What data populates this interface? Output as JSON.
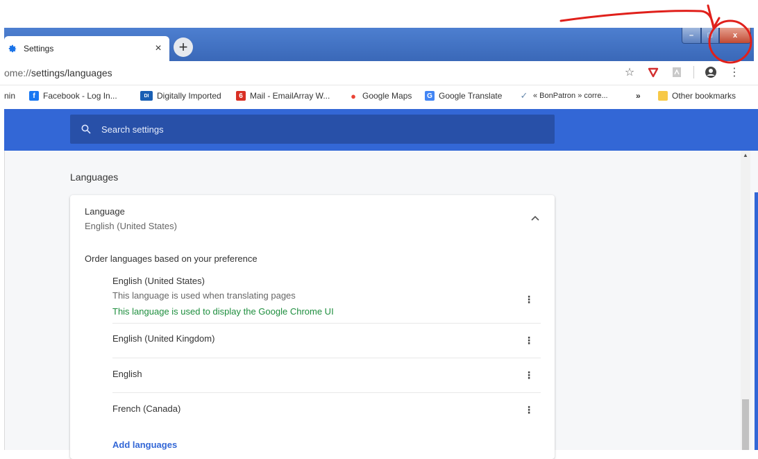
{
  "tab": {
    "title": "Settings",
    "close": "×",
    "new_tab": "+"
  },
  "window_controls": {
    "minimize": "–",
    "maximize": "□",
    "close": "x"
  },
  "omnibox": {
    "url_prefix": "ome://",
    "url_path": "settings/languages"
  },
  "bookmarks": [
    {
      "label": "nin",
      "icon_color": ""
    },
    {
      "label": "Facebook - Log In...",
      "icon_color": "#1877f2",
      "icon_glyph": "f"
    },
    {
      "label": "Digitally Imported",
      "icon_color": "#1a5fb4",
      "icon_glyph": "DI"
    },
    {
      "label": "Mail - EmailArray W...",
      "icon_color": "#d93025",
      "icon_glyph": "6"
    },
    {
      "label": "Google Maps",
      "icon_color": "#ea4335",
      "icon_glyph": "●"
    },
    {
      "label": "Google Translate",
      "icon_color": "#4285f4",
      "icon_glyph": "G"
    },
    {
      "label": "« BonPatron » corre...",
      "icon_color": "#6a8caf",
      "icon_glyph": "✓"
    },
    {
      "label": "»",
      "icon_color": ""
    },
    {
      "label": "Other bookmarks",
      "icon_color": "#f7c948"
    }
  ],
  "search": {
    "placeholder": "Search settings"
  },
  "section": {
    "title": "Languages"
  },
  "language": {
    "title": "Language",
    "current": "English (United States)",
    "order_label": "Order languages based on your preference",
    "items": [
      {
        "name": "English (United States)",
        "sub": "This language is used when translating pages",
        "note": "This language is used to display the Google Chrome UI"
      },
      {
        "name": "English (United Kingdom)"
      },
      {
        "name": "English"
      },
      {
        "name": "French (Canada)"
      }
    ],
    "add_label": "Add languages"
  },
  "colors": {
    "accent": "#3367d6",
    "green": "#1e8e3e",
    "annotation": "#e0201b"
  }
}
